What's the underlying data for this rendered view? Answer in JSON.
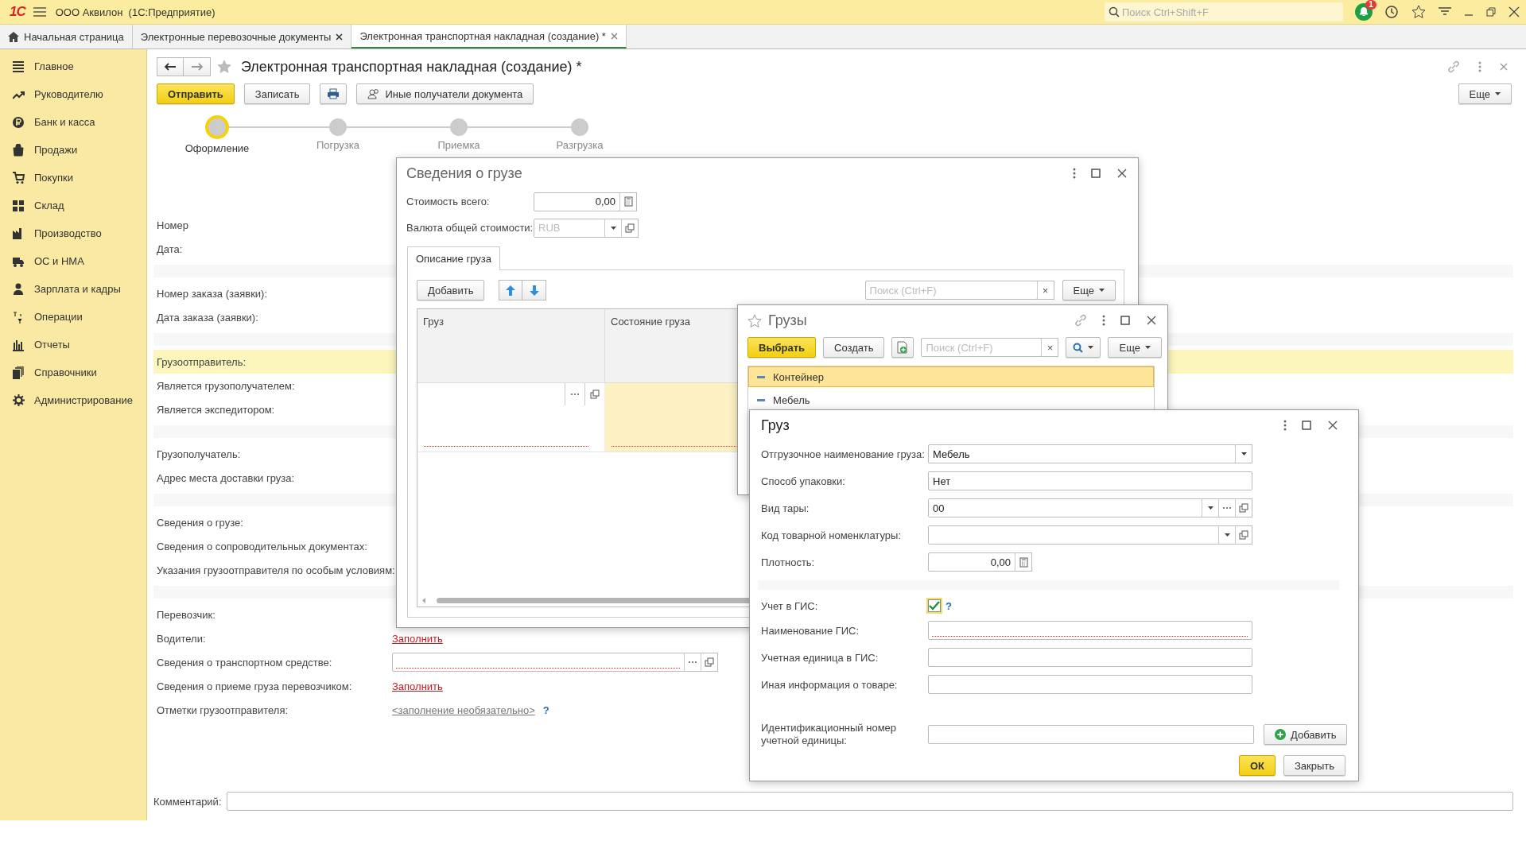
{
  "app": {
    "logo": "1С",
    "title": "ООО Аквилон  (1С:Предприятие)",
    "search": {
      "placeholder": "Поиск Ctrl+Shift+F"
    },
    "notifications": "1"
  },
  "tabs": [
    {
      "label": "Начальная страница",
      "kind": "home",
      "selected": false
    },
    {
      "label": "Электронные перевозочные документы",
      "kind": "doc",
      "selected": false
    },
    {
      "label": "Электронная транспортная накладная (создание) *",
      "kind": "doc",
      "selected": true
    }
  ],
  "sidebar": {
    "items": [
      {
        "label": "Главное"
      },
      {
        "label": "Руководителю"
      },
      {
        "label": "Банк и касса"
      },
      {
        "label": "Продажи"
      },
      {
        "label": "Покупки"
      },
      {
        "label": "Склад"
      },
      {
        "label": "Производство"
      },
      {
        "label": "ОС и НМА"
      },
      {
        "label": "Зарплата и кадры"
      },
      {
        "label": "Операции"
      },
      {
        "label": "Отчеты"
      },
      {
        "label": "Справочники"
      },
      {
        "label": "Администрирование"
      }
    ]
  },
  "form": {
    "title": "Электронная транспортная накладная (создание) *",
    "buttons": [
      {
        "label": "Отправить",
        "kind": "primary"
      },
      {
        "label": "Записать",
        "kind": "normal"
      },
      {
        "kind": "print"
      },
      {
        "label": "Иные получатели документа",
        "kind": "people"
      }
    ],
    "more": "Еще",
    "steps": [
      {
        "label": "Оформление",
        "selected": true
      },
      {
        "label": "Погрузка",
        "selected": false
      },
      {
        "label": "Приемка",
        "selected": false
      },
      {
        "label": "Разгрузка",
        "selected": false
      }
    ],
    "groups": [
      [
        {
          "label": "Номер",
          "kind": "label",
          "highlighted": false
        },
        {
          "label": "Дата:",
          "kind": "label",
          "highlighted": false
        }
      ],
      [
        {
          "label": "Номер заказа (заявки):",
          "kind": "label",
          "highlighted": false
        },
        {
          "label": "Дата заказа (заявки):",
          "kind": "label",
          "highlighted": false
        }
      ],
      [
        {
          "label": "Грузоотправитель:",
          "kind": "label",
          "highlighted": true
        },
        {
          "label": "Является грузополучателем:",
          "kind": "label",
          "highlighted": false
        },
        {
          "label": "Является экспедитором:",
          "kind": "label",
          "highlighted": false
        }
      ],
      [
        {
          "label": "Грузополучатель:",
          "kind": "label",
          "highlighted": false
        },
        {
          "label": "Адрес места доставки груза:",
          "kind": "label",
          "highlighted": false
        }
      ],
      [
        {
          "label": "Сведения о грузе:",
          "kind": "label",
          "highlighted": false
        },
        {
          "label": "Сведения о сопроводительных документах:",
          "kind": "label",
          "highlighted": false
        },
        {
          "label": "Указания грузоотправителя по особым условиям:",
          "kind": "label",
          "highlighted": false
        }
      ],
      [
        {
          "label": "Перевозчик:",
          "kind": "label",
          "highlighted": false
        },
        {
          "label": "Водители:",
          "kind": "link",
          "value": "Заполнить",
          "highlighted": false
        },
        {
          "label": "Сведения о транспортном средстве:",
          "kind": "field",
          "required": true,
          "highlighted": false
        },
        {
          "label": "Сведения о приеме груза перевозчиком:",
          "kind": "link",
          "value": "Заполнить",
          "highlighted": false
        },
        {
          "label": "Отметки грузоотправителя:",
          "kind": "hint",
          "value": "<заполнение необязательно>",
          "help": "?",
          "highlighted": false
        }
      ]
    ],
    "comment": {
      "label": "Комментарий:"
    }
  },
  "cargo_info": {
    "title": "Сведения о грузе",
    "total": {
      "label": "Стоимость всего:",
      "value": "0,00"
    },
    "currency": {
      "label": "Валюта общей стоимости:",
      "placeholder": "RUB"
    },
    "tabs": [
      {
        "label": "Описание груза",
        "selected": true
      }
    ],
    "toolbar": {
      "add": "Добавить",
      "search": {
        "placeholder": "Поиск (Ctrl+F)",
        "clear": "×"
      },
      "more": "Еще"
    },
    "table": {
      "columns": [
        {
          "label": "Груз"
        },
        {
          "label": "Состояние груза"
        }
      ],
      "rows": [
        {
          "cells": [
            {
              "kind": "pick",
              "required": true,
              "selected": false
            },
            {
              "kind": "plain",
              "required": true,
              "selected": true
            }
          ]
        }
      ]
    }
  },
  "cargos": {
    "title": "Грузы",
    "toolbar": {
      "select": "Выбрать",
      "create": "Создать",
      "search": {
        "placeholder": "Поиск (Ctrl+F)",
        "clear": "×"
      },
      "more": "Еще"
    },
    "items": [
      {
        "label": "Контейнер",
        "selected": true
      },
      {
        "label": "Мебель",
        "selected": false
      }
    ]
  },
  "cargo": {
    "title": "Груз",
    "fields": [
      {
        "label": "Отгрузочное наименование груза:",
        "kind": "dropdown",
        "value": "Мебель",
        "required": false
      },
      {
        "label": "Способ упаковки:",
        "kind": "text",
        "value": "Нет",
        "required": false
      },
      {
        "label": "Вид тары:",
        "kind": "dropdown_pick_open",
        "value": "00",
        "required": false
      },
      {
        "label": "Код товарной номенклатуры:",
        "kind": "dropdown_open",
        "required": false
      },
      {
        "label": "Плотность:",
        "kind": "number",
        "value": "0,00",
        "required": false
      }
    ],
    "gis": [
      {
        "label": "Учет в ГИС:",
        "kind": "checkbox",
        "checked": true,
        "help": "?"
      },
      {
        "label": "Наименование ГИС:",
        "kind": "text",
        "required": true
      },
      {
        "label": "Учетная единица в ГИС:",
        "kind": "text",
        "required": false
      },
      {
        "label": "Иная информация о товаре:",
        "kind": "text",
        "required": false
      }
    ],
    "identifier": {
      "label": "Идентификационный номер учетной единицы:",
      "button": "Добавить"
    },
    "buttons": [
      {
        "label": "ОК",
        "kind": "primary"
      },
      {
        "label": "Закрыть",
        "kind": "normal"
      }
    ]
  }
}
